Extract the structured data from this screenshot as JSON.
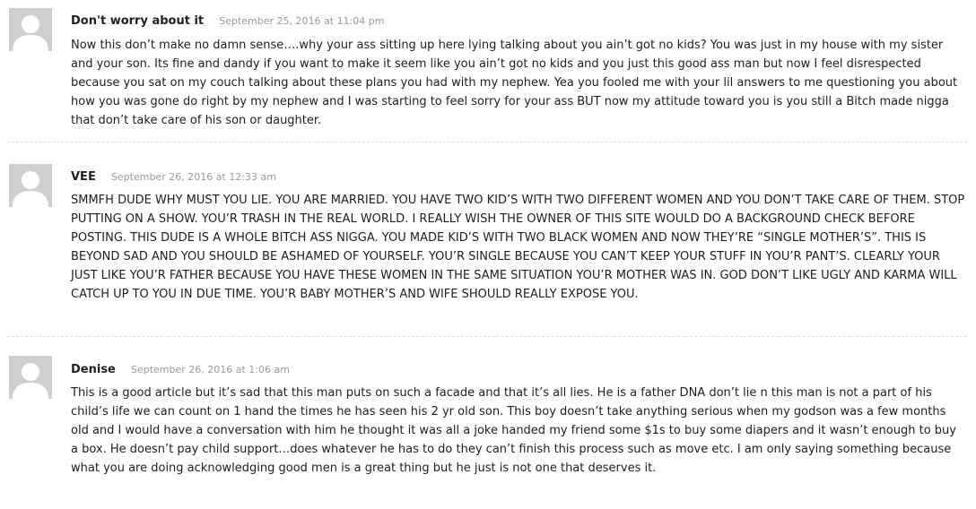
{
  "comments": [
    {
      "author": "Don't worry about it",
      "date": "September 25, 2016 at 11:04 pm",
      "text": "Now this don’t make no damn sense….why your ass sitting up here lying talking about you ain’t got no kids? You was just in my house with my sister and your son. Its fine and dandy if you want to make it seem like you ain’t got no kids and you just this good ass man but now I feel disrespected because you sat on my couch talking about these plans you had with my nephew. Yea you fooled me with your lil answers to me questioning you about how you was gone do right by my nephew and I was starting to feel sorry for your ass BUT now my attitude toward you is you still a Bitch made nigga that don’t take care of his son or daughter."
    },
    {
      "author": "VEE",
      "date": "September 26, 2016 at 12:33 am",
      "text": "SMMFH DUDE WHY MUST YOU LIE. YOU ARE MARRIED. YOU HAVE TWO KID’S WITH TWO DIFFERENT WOMEN AND YOU DON’T TAKE CARE OF THEM. STOP PUTTING ON A SHOW. YOU’R TRASH IN THE REAL WORLD. I REALLY WISH THE OWNER OF THIS SITE WOULD DO A BACKGROUND CHECK BEFORE POSTING. THIS DUDE IS A WHOLE BITCH ASS NIGGA. YOU MADE KID’S WITH TWO BLACK WOMEN AND NOW THEY’RE “SINGLE MOTHER’S”. THIS IS BEYOND SAD AND YOU SHOULD BE ASHAMED OF YOURSELF. YOU’R SINGLE BECAUSE YOU CAN’T KEEP YOUR STUFF IN YOU’R PANT’S. CLEARLY YOUR JUST LIKE YOU’R FATHER BECAUSE YOU HAVE THESE WOMEN IN THE SAME SITUATION YOU’R MOTHER WAS IN. GOD DON’T LIKE UGLY AND KARMA WILL CATCH UP TO YOU IN DUE TIME. YOU’R BABY MOTHER’S AND WIFE SHOULD REALLY EXPOSE YOU."
    },
    {
      "author": "Denise",
      "date": "September 26, 2016 at 1:06 am",
      "text": "This is a good article but it’s sad that this man puts on such a facade and that it’s all lies. He is a father DNA don’t lie n this man is not a part of his child’s life we can count on 1 hand the times he has seen his 2 yr old son. This boy doesn’t take anything serious when my godson was a few months old and I would have a conversation with him he thought it was all a joke handed my friend some $1s to buy some diapers and it wasn’t enough to buy a box. He doesn’t pay child support…does whatever he has to do they can’t finish this process such as move etc. I am only saying something because what you are doing acknowledging good men is a great thing but he just is not one that deserves it."
    }
  ],
  "icons": {
    "avatar": "default-avatar-icon"
  },
  "colors": {
    "avatar_bg": "#cfcfcf",
    "avatar_fg": "#ffffff",
    "date": "#9a9a9a",
    "separator": "#dedede"
  }
}
